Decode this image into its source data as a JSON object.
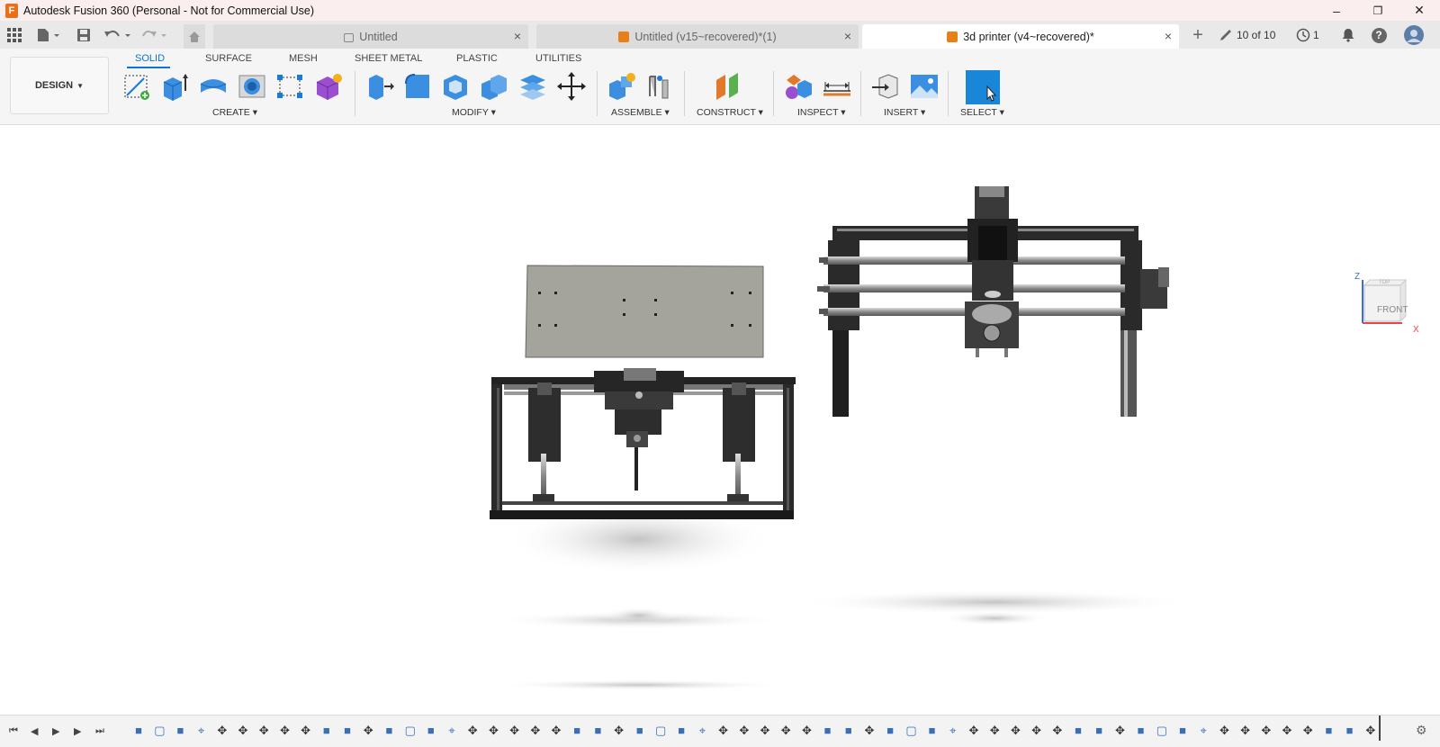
{
  "window": {
    "title": "Autodesk Fusion 360 (Personal - Not for Commercial Use)",
    "logo_letter": "F",
    "minimize": "–",
    "maximize": "❐",
    "close": "✕"
  },
  "tabs": [
    {
      "label": "Untitled",
      "icon": "lock-icon"
    },
    {
      "label": "Untitled (v15~recovered)*(1)",
      "icon": "component-icon"
    },
    {
      "label": "3d printer (v4~recovered)*",
      "icon": "component-icon",
      "active": true
    }
  ],
  "tab_close": "×",
  "tabbar": {
    "add_tab": "+",
    "job_status": "10 of 10",
    "notifications_count": "1",
    "help": "?"
  },
  "workspace": {
    "mode": "DESIGN",
    "tabs": [
      "SOLID",
      "SURFACE",
      "MESH",
      "SHEET METAL",
      "PLASTIC",
      "UTILITIES"
    ],
    "active_tab": "SOLID"
  },
  "groups": {
    "create": "CREATE",
    "modify": "MODIFY",
    "assemble": "ASSEMBLE",
    "construct": "CONSTRUCT",
    "inspect": "INSPECT",
    "insert": "INSERT",
    "select": "SELECT"
  },
  "colors": {
    "accent": "#0b74d8",
    "select_highlight": "#1a86d8",
    "orange": "#e8801a"
  },
  "viewcube": {
    "face": "FRONT",
    "top": "TOP",
    "axis_z": "Z",
    "axis_x": "X"
  },
  "timeline": {
    "feature_count": 60
  }
}
